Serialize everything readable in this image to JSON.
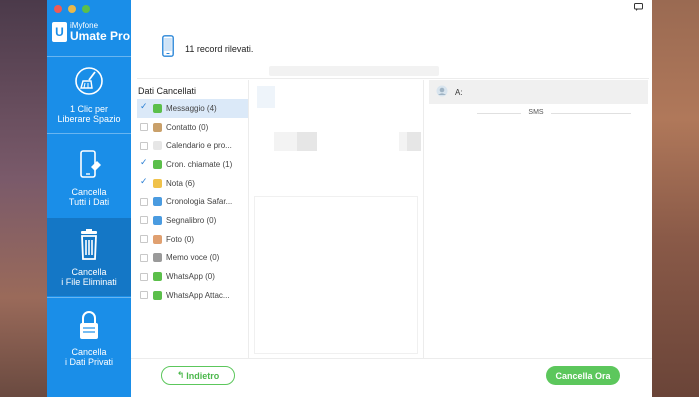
{
  "app": {
    "brand_small": "iMyfone",
    "brand_name": "Umate Pro",
    "logo_letter": "U"
  },
  "sidebar": {
    "items": [
      {
        "line1": "1 Clic per",
        "line2": "Liberare Spazio",
        "icon": "broom-icon",
        "active": false
      },
      {
        "line1": "Cancella",
        "line2": "Tutti i Dati",
        "icon": "phone-eraser-icon",
        "active": false
      },
      {
        "line1": "Cancella",
        "line2": "i File Eliminati",
        "icon": "trash-icon",
        "active": true
      },
      {
        "line1": "Cancella",
        "line2": "i Dati Privati",
        "icon": "lock-icon",
        "active": false
      }
    ]
  },
  "header": {
    "record_text": "11 record rilevati.",
    "icon": "phone-icon"
  },
  "categories": {
    "title": "Dati Cancellati",
    "items": [
      {
        "label": "Messaggio (4)",
        "checked": true,
        "selected": true,
        "icon": "message-icon",
        "color": "#5bbf4a"
      },
      {
        "label": "Contatto (0)",
        "checked": false,
        "selected": false,
        "icon": "contact-icon",
        "color": "#c9a06a"
      },
      {
        "label": "Calendario e pro...",
        "checked": false,
        "selected": false,
        "icon": "calendar-icon",
        "color": "#e6e6e6"
      },
      {
        "label": "Cron. chiamate (1)",
        "checked": true,
        "selected": false,
        "icon": "call-log-icon",
        "color": "#5bbf4a"
      },
      {
        "label": "Nota (6)",
        "checked": true,
        "selected": false,
        "icon": "note-icon",
        "color": "#f0c24a"
      },
      {
        "label": "Cronologia Safar...",
        "checked": false,
        "selected": false,
        "icon": "safari-icon",
        "color": "#4a9be0"
      },
      {
        "label": "Segnalibro (0)",
        "checked": false,
        "selected": false,
        "icon": "bookmark-icon",
        "color": "#4a9be0"
      },
      {
        "label": "Foto (0)",
        "checked": false,
        "selected": false,
        "icon": "photo-icon",
        "color": "#e0a070"
      },
      {
        "label": "Memo voce (0)",
        "checked": false,
        "selected": false,
        "icon": "voice-memo-icon",
        "color": "#9a9a9a"
      },
      {
        "label": "WhatsApp (0)",
        "checked": false,
        "selected": false,
        "icon": "whatsapp-icon",
        "color": "#5bbf4a"
      },
      {
        "label": "WhatsApp Attac...",
        "checked": false,
        "selected": false,
        "icon": "whatsapp-attachment-icon",
        "color": "#5bbf4a"
      }
    ]
  },
  "detail": {
    "to_label": "A:",
    "sms_label": "SMS"
  },
  "footer": {
    "back_label": "Indietro",
    "delete_label": "Cancella Ora"
  },
  "colors": {
    "sidebar": "#1a8ee8",
    "sidebar_active": "#1477c6",
    "accent_green": "#5cc75c",
    "selected_row": "#dbe9f8"
  }
}
